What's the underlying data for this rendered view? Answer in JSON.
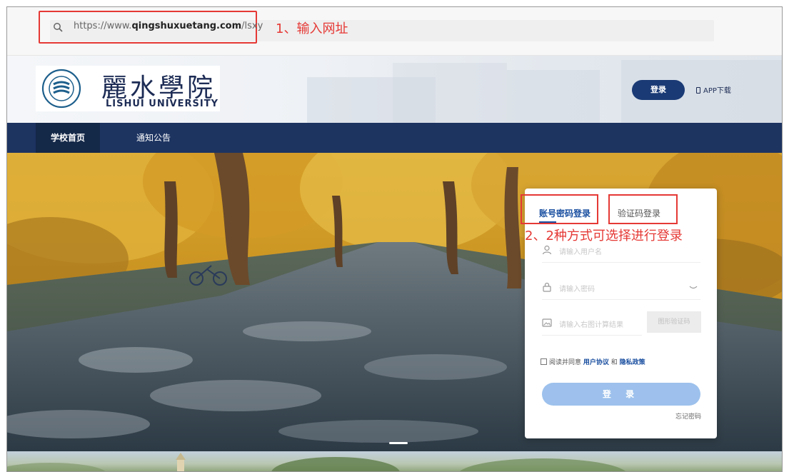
{
  "browser": {
    "url_prefix": "https://www.",
    "url_domain": "qingshuxuetang.com",
    "url_path": "/lsxy"
  },
  "annotations": {
    "step1": "1、输入网址",
    "step2": "2、2种方式可选择进行登录"
  },
  "header": {
    "logo_cn": "麗水學院",
    "logo_en": "LISHUI UNIVERSITY",
    "login_button": "登录",
    "app_download": "APP下载"
  },
  "nav": {
    "items": [
      "学校首页",
      "通知公告"
    ]
  },
  "login": {
    "tabs": [
      "账号密码登录",
      "验证码登录"
    ],
    "username_placeholder": "请输入用户名",
    "password_placeholder": "请输入密码",
    "captcha_placeholder": "请输入右图计算结果",
    "captcha_button": "图形验证码",
    "agree_prefix": "阅读并同意",
    "agree_user_agreement": "用户协议",
    "agree_and": "和",
    "agree_privacy": "隐私政策",
    "submit": "登 录",
    "forgot_password": "忘记密码"
  },
  "colors": {
    "annotation_red": "#e53935",
    "nav_bg": "#1d3461",
    "accent_blue": "#1a4fa0",
    "submit_bg": "#9dc1ec"
  }
}
